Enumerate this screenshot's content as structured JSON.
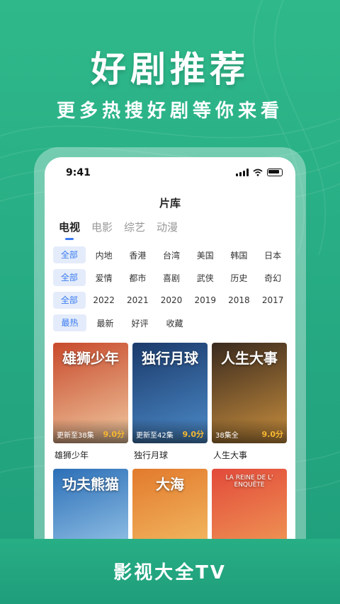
{
  "hero": {
    "title": "好剧推荐",
    "subtitle": "更多热搜好剧等你来看"
  },
  "status": {
    "time": "9:41"
  },
  "nav": {
    "title": "片库"
  },
  "tabs": [
    {
      "label": "电视"
    },
    {
      "label": "电影"
    },
    {
      "label": "综艺"
    },
    {
      "label": "动漫"
    }
  ],
  "filters": {
    "region": [
      "全部",
      "内地",
      "香港",
      "台湾",
      "美国",
      "韩国",
      "日本"
    ],
    "genre": [
      "全部",
      "爱情",
      "都市",
      "喜剧",
      "武侠",
      "历史",
      "奇幻"
    ],
    "year": [
      "全部",
      "2022",
      "2021",
      "2020",
      "2019",
      "2018",
      "2017"
    ],
    "sort": [
      "最热",
      "最新",
      "好评",
      "收藏"
    ]
  },
  "movies": [
    {
      "title": "雄狮少年",
      "badge": "更新至38集",
      "score": "9.0分",
      "poster_text": "雄狮少年",
      "colors": [
        "#c84a2c",
        "#f0c9a0"
      ]
    },
    {
      "title": "独行月球",
      "badge": "更新至42集",
      "score": "9.0分",
      "poster_text": "独行月球",
      "colors": [
        "#1b3a6b",
        "#4c8bc9"
      ]
    },
    {
      "title": "人生大事",
      "badge": "38集全",
      "score": "9.0分",
      "poster_text": "人生大事",
      "colors": [
        "#3a2a1e",
        "#c98f3e"
      ]
    },
    {
      "title": "",
      "badge": "",
      "score": "",
      "poster_text": "功夫熊猫",
      "colors": [
        "#2c6fb7",
        "#a6d1ef"
      ]
    },
    {
      "title": "",
      "badge": "",
      "score": "",
      "poster_text": "大海",
      "colors": [
        "#e27a2c",
        "#f6c56c"
      ]
    },
    {
      "title": "",
      "badge": "",
      "score": "",
      "poster_text": "LA REINE DE L' ENQUÊTE",
      "colors": [
        "#e24a3a",
        "#f2a55a"
      ]
    }
  ],
  "footer": {
    "label": "影视大全TV"
  },
  "theme": {
    "accent": "#3a7bf0",
    "brand": "#2fb98a",
    "score": "#f5b731"
  }
}
